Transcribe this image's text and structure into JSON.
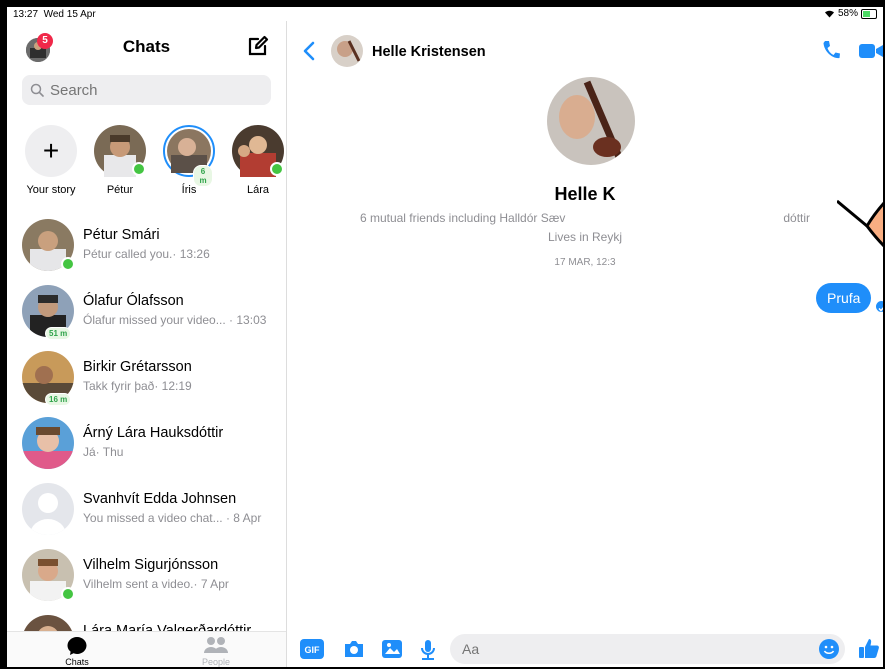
{
  "status": {
    "time": "13:27",
    "date": "Wed 15 Apr",
    "battery": "58%"
  },
  "sidebar": {
    "title": "Chats",
    "notifications": "5",
    "search_placeholder": "Search",
    "stories": [
      {
        "label": "Your story"
      },
      {
        "label": "Pétur"
      },
      {
        "label": "Íris",
        "chip": "6 m"
      },
      {
        "label": "Lára"
      }
    ],
    "conversations": [
      {
        "name": "Pétur Smári",
        "snippet": "Pétur called you.· 13:26"
      },
      {
        "name": "Ólafur Ólafsson",
        "snippet": "Ólafur missed your video... · 13:03",
        "chip": "51 m"
      },
      {
        "name": "Birkir Grétarsson",
        "snippet": "Takk fyrir það· 12:19",
        "chip": "16 m"
      },
      {
        "name": "Árný Lára Hauksdóttir",
        "snippet": "Já· Thu"
      },
      {
        "name": "Svanhvít Edda Johnsen",
        "snippet": "You missed a video chat...  · 8 Apr"
      },
      {
        "name": "Vilhelm Sigurjónsson",
        "snippet": "Vilhelm sent a video.· 7 Apr"
      },
      {
        "name": "Lára María Valgerðardóttir",
        "snippet": ""
      }
    ],
    "tabs": [
      {
        "label": "Chats"
      },
      {
        "label": "People"
      }
    ]
  },
  "chat": {
    "contact_name": "Helle Kristensen",
    "profile_name": "Helle K",
    "profile_mutual": "6 mutual friends including Halldór Sæv",
    "profile_mutual_tail": "dóttir",
    "profile_location": "Lives in Reykj",
    "date_stamp": "17 MAR, 12:3",
    "message": "Prufa",
    "input_placeholder": "Aa",
    "gif_label": "GIF"
  },
  "colors": {
    "accent": "#1f8efa",
    "badge": "#f02849",
    "online": "#44c542"
  }
}
